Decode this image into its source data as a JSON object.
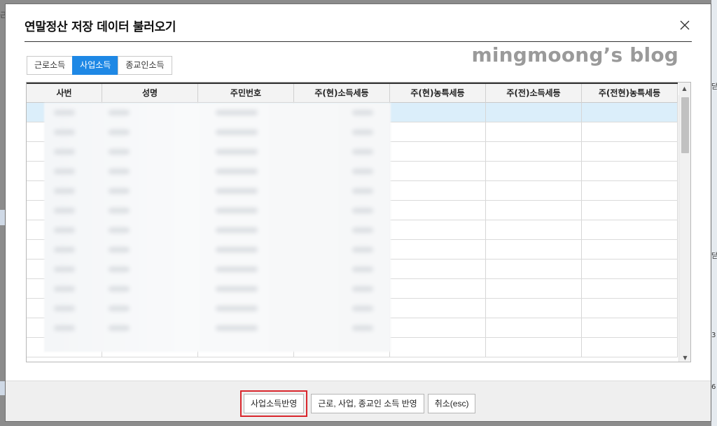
{
  "dialog": {
    "title": "연말정산 저장 데이터 불러오기",
    "close_icon": "close-icon"
  },
  "tabs": [
    {
      "label": "근로소득",
      "active": false
    },
    {
      "label": "사업소득",
      "active": true
    },
    {
      "label": "종교인소득",
      "active": false
    }
  ],
  "watermark": "mingmoong’s blog",
  "grid": {
    "columns": [
      "사번",
      "성명",
      "주민번호",
      "주(현)소득세등",
      "주(현)농특세등",
      "주(전)소득세등",
      "주(전현)농특세등"
    ],
    "selected_row": 0
  },
  "footer": {
    "apply_business_label": "사업소득반영",
    "apply_all_label": "근로, 사업, 종교인 소득 반영",
    "cancel_label": "취소(esc)"
  },
  "background_edge": {
    "t1": "근",
    "t2": "닫",
    "t3": "닫",
    "t4": "3",
    "t5": "6"
  },
  "colors": {
    "active_tab": "#1e88e5",
    "selected_row": "#dbeefa",
    "highlight_border": "#d9262c"
  }
}
